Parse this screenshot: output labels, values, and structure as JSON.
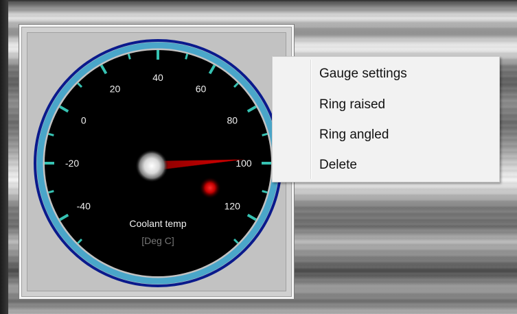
{
  "gauge": {
    "title": "Coolant temp",
    "unit": "[Deg C]",
    "scale_labels": [
      "-40",
      "-20",
      "0",
      "20",
      "40",
      "60",
      "80",
      "100",
      "120"
    ],
    "scale_min": -50,
    "scale_max": 130,
    "needle_value": 100,
    "colors": {
      "face": "#000000",
      "ring_outer": "#0a1a8c",
      "ring_inner": "#4aa6c9",
      "ticks": "#36c2b2",
      "needle": "#cc0000",
      "warning_led": "#e00000"
    }
  },
  "context_menu": {
    "items": [
      {
        "label": "Gauge settings"
      },
      {
        "label": "Ring raised"
      },
      {
        "label": "Ring angled"
      },
      {
        "label": "Delete"
      }
    ]
  }
}
